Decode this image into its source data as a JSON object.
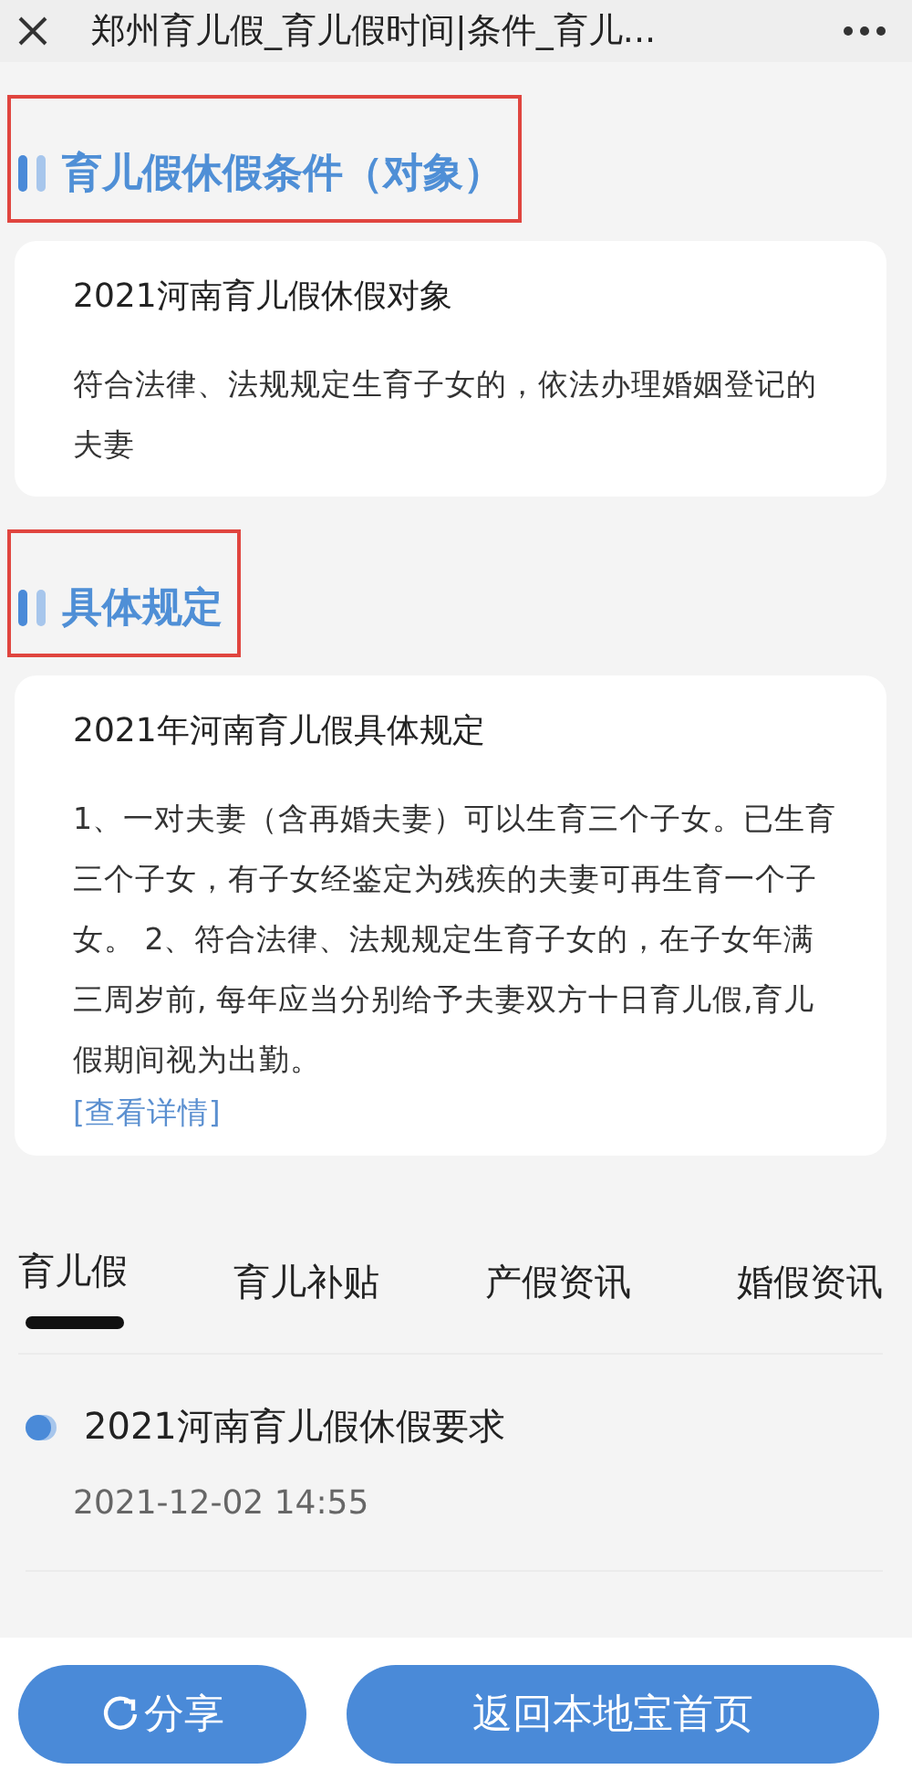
{
  "window": {
    "title": "郑州育儿假_育儿假时间|条件_育儿..."
  },
  "sections": [
    {
      "heading": "育儿假休假条件（对象）",
      "highlighted": true,
      "card": {
        "title": "2021河南育儿假休假对象",
        "body": "符合法律、法规规定生育子女的，依法办理婚姻登记的夫妻"
      }
    },
    {
      "heading": "具体规定",
      "highlighted": true,
      "card": {
        "title": "2021年河南育儿假具体规定",
        "body": "1、一对夫妻（含再婚夫妻）可以生育三个子女。已生育三个子女，有子女经鉴定为残疾的夫妻可再生育一个子女。 2、符合法律、法规规定生育子女的，在子女年满三周岁前, 每年应当分别给予夫妻双方十日育儿假,育儿假期间视为出勤。",
        "link": "[查看详情]"
      }
    }
  ],
  "tabs": [
    {
      "label": "育儿假",
      "selected": true
    },
    {
      "label": "育儿补贴",
      "selected": false
    },
    {
      "label": "产假资讯",
      "selected": false
    },
    {
      "label": "婚假资讯",
      "selected": false
    }
  ],
  "news": [
    {
      "title": "2021河南育儿假休假要求",
      "time": "2021-12-02 14:55"
    }
  ],
  "buttons": [
    {
      "label": "分享",
      "kind": "share"
    },
    {
      "label": "返回本地宝首页",
      "kind": "plain"
    }
  ]
}
